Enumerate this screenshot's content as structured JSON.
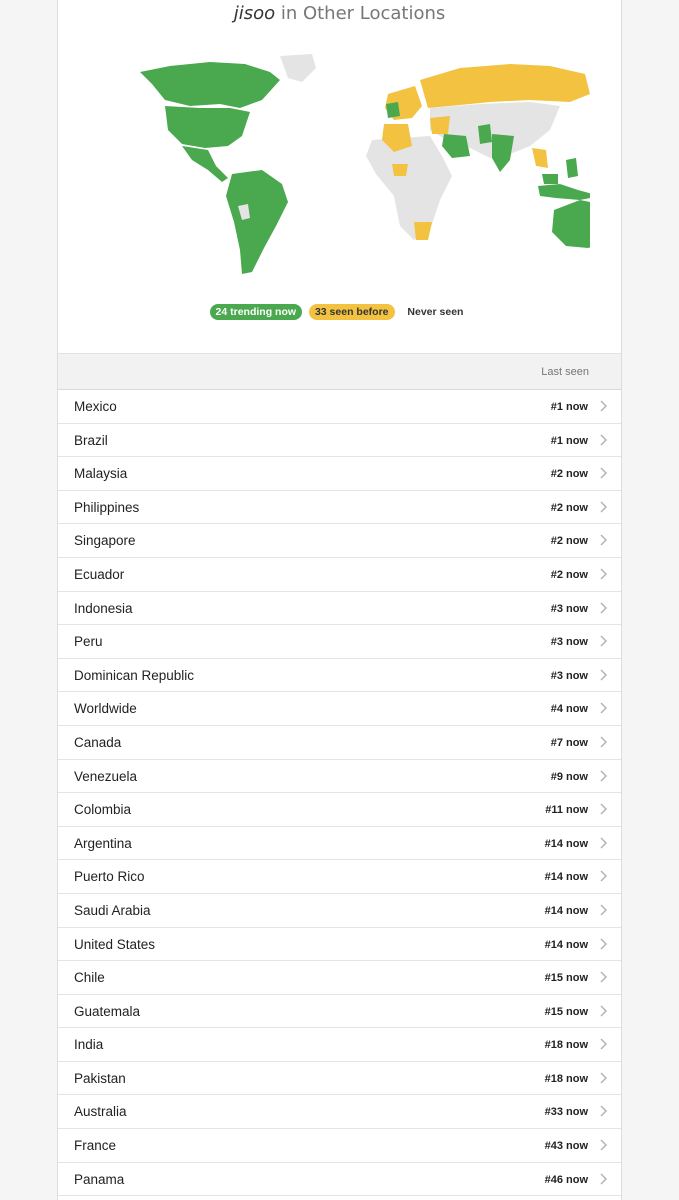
{
  "header": {
    "query": "jisoo",
    "title_suffix": " in Other Locations"
  },
  "legend": {
    "trending": "24 trending now",
    "seen_before": "33 seen before",
    "never_seen": "Never seen"
  },
  "colors": {
    "trending": "#4aa84f",
    "seen_before": "#f2c240",
    "never_seen": "#e4e4e4"
  },
  "table": {
    "last_seen_header": "Last seen",
    "rows": [
      {
        "name": "Mexico",
        "rank": "#1 now"
      },
      {
        "name": "Brazil",
        "rank": "#1 now"
      },
      {
        "name": "Malaysia",
        "rank": "#2 now"
      },
      {
        "name": "Philippines",
        "rank": "#2 now"
      },
      {
        "name": "Singapore",
        "rank": "#2 now"
      },
      {
        "name": "Ecuador",
        "rank": "#2 now"
      },
      {
        "name": "Indonesia",
        "rank": "#3 now"
      },
      {
        "name": "Peru",
        "rank": "#3 now"
      },
      {
        "name": "Dominican Republic",
        "rank": "#3 now"
      },
      {
        "name": "Worldwide",
        "rank": "#4 now"
      },
      {
        "name": "Canada",
        "rank": "#7 now"
      },
      {
        "name": "Venezuela",
        "rank": "#9 now"
      },
      {
        "name": "Colombia",
        "rank": "#11 now"
      },
      {
        "name": "Argentina",
        "rank": "#14 now"
      },
      {
        "name": "Puerto Rico",
        "rank": "#14 now"
      },
      {
        "name": "Saudi Arabia",
        "rank": "#14 now"
      },
      {
        "name": "United States",
        "rank": "#14 now"
      },
      {
        "name": "Chile",
        "rank": "#15 now"
      },
      {
        "name": "Guatemala",
        "rank": "#15 now"
      },
      {
        "name": "India",
        "rank": "#18 now"
      },
      {
        "name": "Pakistan",
        "rank": "#18 now"
      },
      {
        "name": "Australia",
        "rank": "#33 now"
      },
      {
        "name": "France",
        "rank": "#43 now"
      },
      {
        "name": "Panama",
        "rank": "#46 now"
      }
    ]
  }
}
